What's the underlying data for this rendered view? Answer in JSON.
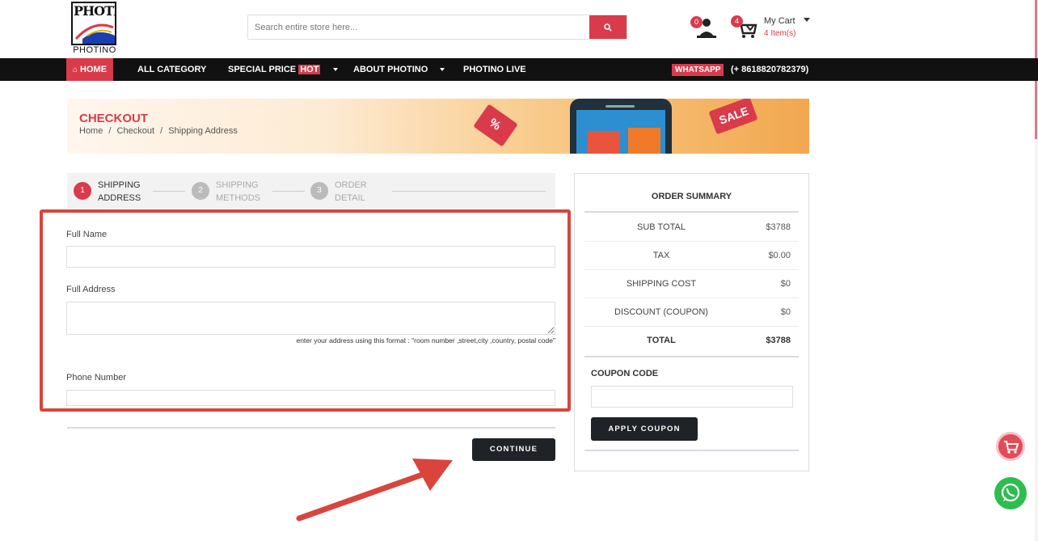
{
  "header": {
    "logo_text": "PHOTINO",
    "logo_caption": "PHOTINO",
    "search_placeholder": "Search entire store here...",
    "wishlist_count": "0",
    "cart_badge": "4",
    "cart_title": "My Cart",
    "cart_items": "4 Item(s)"
  },
  "nav": {
    "home": "HOME",
    "all_category": "ALL CATEGORY",
    "special_price": "SPECIAL PRICE",
    "hot": "HOT",
    "about": "ABOUT PHOTINO",
    "live": "PHOTINO LIVE",
    "whatsapp": "WHATSAPP",
    "phone": "(+ 8618820782379)"
  },
  "banner": {
    "title": "CHECKOUT",
    "breadcrumb": [
      "Home",
      "/",
      "Checkout",
      "/",
      "Shipping Address"
    ],
    "sale_tag": "SALE",
    "percent_tag": "%"
  },
  "steps": [
    {
      "number": "1",
      "line1": "SHIPPING",
      "line2": "ADDRESS",
      "active": true
    },
    {
      "number": "2",
      "line1": "SHIPPING",
      "line2": "METHODS",
      "active": false
    },
    {
      "number": "3",
      "line1": "ORDER",
      "line2": "DETAIL",
      "active": false
    }
  ],
  "form": {
    "full_name_label": "Full Name",
    "full_name_value": "",
    "full_address_label": "Full Address",
    "full_address_value": "",
    "address_hint": "enter your address using this format : \"room number ,street,city ,country, postal code\"",
    "phone_label": "Phone Number",
    "phone_value": ""
  },
  "continue_label": "CONTINUE",
  "summary": {
    "title": "ORDER SUMMARY",
    "rows": [
      {
        "label": "SUB TOTAL",
        "value": "$3788"
      },
      {
        "label": "TAX",
        "value": "$0.00"
      },
      {
        "label": "SHIPPING COST",
        "value": "$0"
      },
      {
        "label": "DISCOUNT (COUPON)",
        "value": "$0"
      },
      {
        "label": "TOTAL",
        "value": "$3788"
      }
    ],
    "coupon_label": "COUPON CODE",
    "coupon_value": "",
    "apply_label": "APPLY COUPON"
  },
  "colors": {
    "accent": "#d93b4b",
    "nav_bg": "#111111",
    "highlight": "#d9453c",
    "button_dark": "#1f2227",
    "whatsapp": "#2ebd4e"
  }
}
